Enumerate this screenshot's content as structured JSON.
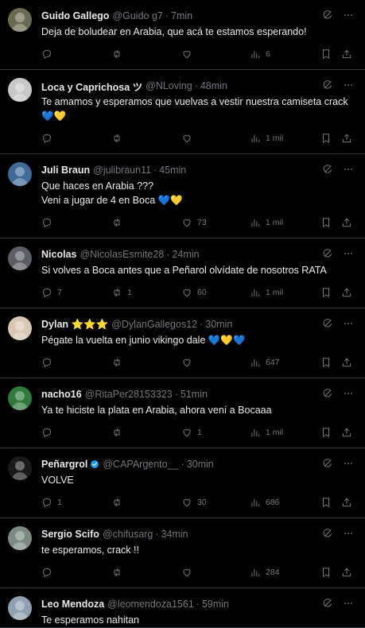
{
  "tweets": [
    {
      "name": "Guido Gallego",
      "handle": "@Guido g7",
      "time": "7min",
      "text": [
        "Deja de boludear en Arabia, que acá te estamos esperando!"
      ],
      "replies": "",
      "retweets": "",
      "likes": "",
      "views": "6",
      "avatar_color": "#6b6a52"
    },
    {
      "name": "Loca y Caprichosa ツ",
      "handle": "@NLoving",
      "time": "48min",
      "text": [
        "Te amamos y esperamos que vuelvas a vestir nuestra camiseta crack 💙💛"
      ],
      "replies": "",
      "retweets": "",
      "likes": "",
      "views": "1 mil",
      "avatar_color": "#c8c8c8"
    },
    {
      "name": "Juli Braun",
      "handle": "@julibraun11",
      "time": "45min",
      "text": [
        "Que haces en Arabia ???",
        "Veni a jugar de 4 en Boca 💙💛"
      ],
      "replies": "",
      "retweets": "",
      "likes": "73",
      "views": "1 mil",
      "avatar_color": "#3f6a9a"
    },
    {
      "name": "Nicolas",
      "handle": "@NicolasEsmite28",
      "time": "24min",
      "text": [
        "Si volves a Boca antes que a Peñarol olvídate de nosotros RATA"
      ],
      "replies": "7",
      "retweets": "1",
      "likes": "60",
      "views": "1 mil",
      "avatar_color": "#5a5f66"
    },
    {
      "name": "Dylan ⭐⭐⭐",
      "handle": "@DylanGallegos12",
      "time": "30min",
      "text": [
        "Pégate la vuelta en junio vikingo dale 💙💛💙"
      ],
      "replies": "",
      "retweets": "",
      "likes": "",
      "views": "647",
      "avatar_color": "#d9c7b5"
    },
    {
      "name": "nacho16",
      "handle": "@RitaPer28153323",
      "time": "51min",
      "text": [
        "Ya te hiciste la plata en Arabia, ahora vení a Bocaaa"
      ],
      "replies": "",
      "retweets": "",
      "likes": "1",
      "views": "1 mil",
      "avatar_color": "#2f7a3a"
    },
    {
      "name": "Peñargrol",
      "handle": "@CAPArgento__",
      "time": "30min",
      "verified": true,
      "text": [
        "VOLVE"
      ],
      "replies": "1",
      "retweets": "",
      "likes": "30",
      "views": "686",
      "avatar_color": "#1a1a1a"
    },
    {
      "name": "Sergio Scifo",
      "handle": "@chifusarg",
      "time": "34min",
      "text": [
        "te esperamos, crack !!"
      ],
      "replies": "",
      "retweets": "",
      "likes": "",
      "views": "284",
      "avatar_color": "#7a8a7f"
    },
    {
      "name": "Leo Mendoza",
      "handle": "@leomendoza1561",
      "time": "59min",
      "text": [
        "Te esperamos nahitan"
      ],
      "replies": "",
      "retweets": "",
      "likes": "",
      "views": "",
      "avatar_color": "#8fa0b0"
    }
  ],
  "colors": {
    "background": "#000000",
    "text": "#e7e9ea",
    "muted": "#71767b",
    "divider": "#2f3336",
    "verified": "#1d9bf0"
  },
  "icons": {
    "reply": "reply-icon",
    "retweet": "retweet-icon",
    "like": "like-icon",
    "views": "views-icon",
    "bookmark": "bookmark-icon",
    "share": "share-icon",
    "grok": "grok-icon",
    "more": "more-icon"
  }
}
